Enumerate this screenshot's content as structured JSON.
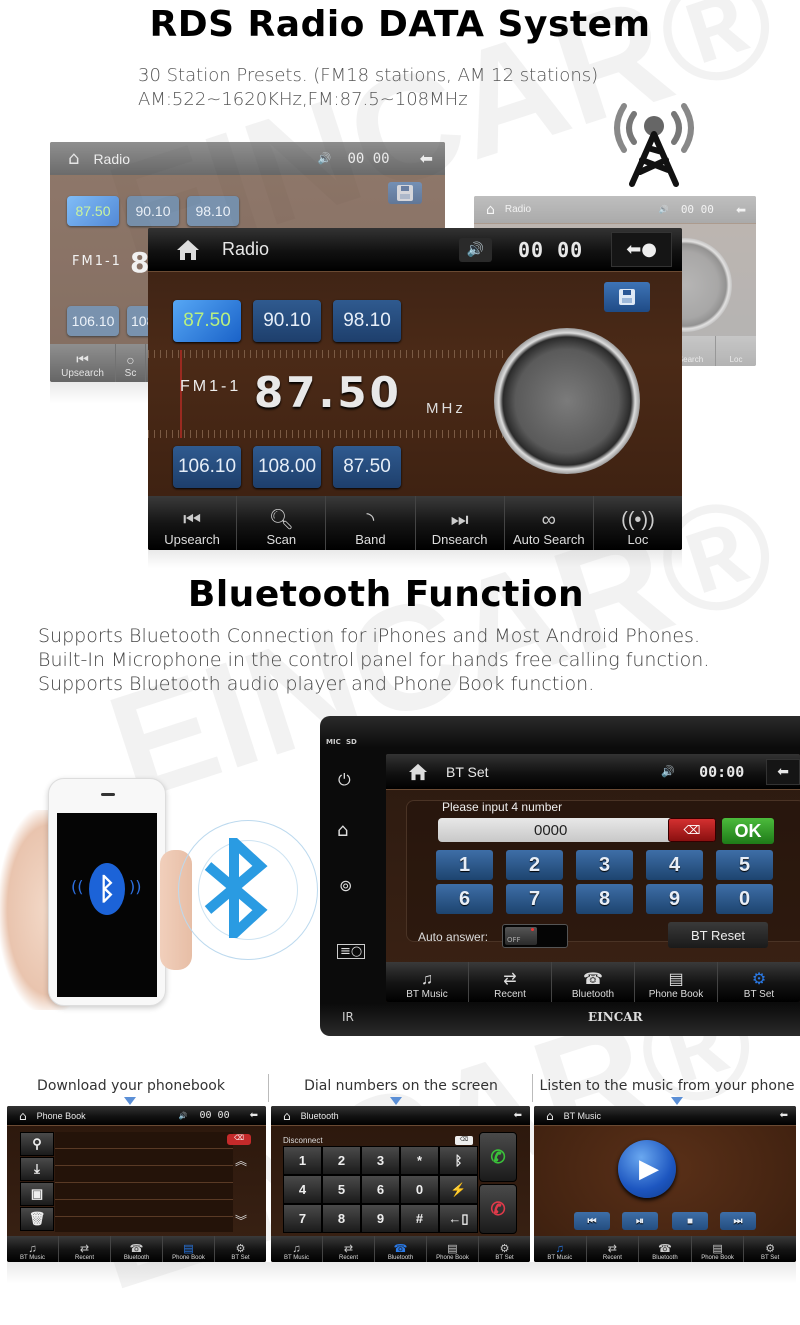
{
  "radio_section": {
    "heading": "RDS Radio DATA System",
    "desc_line1": "30 Station Presets. (FM18 stations, AM 12 stations)",
    "desc_line2": "AM:522~1620KHz,FM:87.5~108MHz",
    "tower_icon": "radio-tower-icon",
    "screen": {
      "title": "Radio",
      "clock": "00 00",
      "presets_top": [
        "87.50",
        "90.10",
        "98.10"
      ],
      "presets_bottom": [
        "106.10",
        "108.00",
        "87.50"
      ],
      "active_preset": "87.50",
      "band_label": "FM1-1",
      "frequency": "87.50",
      "unit": "MHz",
      "bottom_buttons": [
        {
          "label": "Upsearch",
          "icon": "skip-back-icon"
        },
        {
          "label": "Scan",
          "icon": "search-icon"
        },
        {
          "label": "Band",
          "icon": "band-waves-icon"
        },
        {
          "label": "Dnsearch",
          "icon": "skip-forward-icon"
        },
        {
          "label": "Auto Search",
          "icon": "auto-search-icon"
        },
        {
          "label": "Loc",
          "icon": "antenna-icon"
        }
      ]
    },
    "back_screen_left": {
      "title": "Radio",
      "clock": "00 00",
      "presets_top": [
        "87.50",
        "90.10",
        "98.10"
      ],
      "presets_bottom": [
        "106.10",
        "108"
      ],
      "band_label": "FM1-1",
      "frequency_partial": "8",
      "bottom_buttons": [
        "Upsearch",
        "Sc"
      ]
    },
    "back_screen_right": {
      "title": "Radio",
      "clock": "00 00",
      "bottom_buttons": [
        "Search",
        "Loc"
      ]
    }
  },
  "bluetooth_section": {
    "heading": "Bluetooth Function",
    "desc_lines": [
      "Supports Bluetooth Connection for iPhones and Most Android Phones.",
      "Built-In Microphone in the control panel for hands free calling function.",
      "Supports Bluetooth audio player and Phone Book function."
    ],
    "head_unit": {
      "panel_labels": {
        "mic": "MIC",
        "sd": "SD",
        "ir": "IR"
      },
      "brand": "EINCAR",
      "side_icons": [
        "power-icon",
        "home-icon",
        "navigation-icon",
        "radio-icon"
      ],
      "screen": {
        "title": "BT Set",
        "clock": "00:00",
        "prompt": "Please input 4 number",
        "pin_value": "0000",
        "ok_label": "OK",
        "keypad": [
          "1",
          "2",
          "3",
          "4",
          "5",
          "6",
          "7",
          "8",
          "9",
          "0"
        ],
        "auto_answer_label": "Auto answer:",
        "auto_answer_state": "OFF",
        "reset_label": "BT Reset",
        "bottom_tabs": [
          {
            "label": "BT Music",
            "icon": "music-icon"
          },
          {
            "label": "Recent",
            "icon": "recent-calls-icon"
          },
          {
            "label": "Bluetooth",
            "icon": "phone-icon"
          },
          {
            "label": "Phone Book",
            "icon": "phonebook-icon"
          },
          {
            "label": "BT Set",
            "icon": "gear-icon",
            "active": true
          }
        ]
      }
    }
  },
  "feature_panels": [
    {
      "caption": "Download your phonebook",
      "screen_title": "Phone Book",
      "clock": "00 00",
      "side_buttons": [
        "search-icon",
        "download-icon",
        "save-icon",
        "delete-icon"
      ],
      "active_tab": "Phone Book"
    },
    {
      "caption": "Dial numbers on the screen",
      "screen_title": "Bluetooth",
      "status": "Disconnect",
      "keys": [
        "1",
        "2",
        "3",
        "*",
        "bt-icon",
        "4",
        "5",
        "6",
        "0",
        "link-icon",
        "7",
        "8",
        "9",
        "#",
        "transfer-icon"
      ],
      "active_tab": "Bluetooth"
    },
    {
      "caption": "Listen to the music from your phone",
      "screen_title": "BT Music",
      "controls": [
        "previous-icon",
        "play-pause-icon",
        "stop-icon",
        "next-icon"
      ],
      "active_tab": "BT Music"
    }
  ],
  "mini_tabs": [
    "BT Music",
    "Recent",
    "Bluetooth",
    "Phone Book",
    "BT Set"
  ],
  "watermark": "EINCAR®"
}
